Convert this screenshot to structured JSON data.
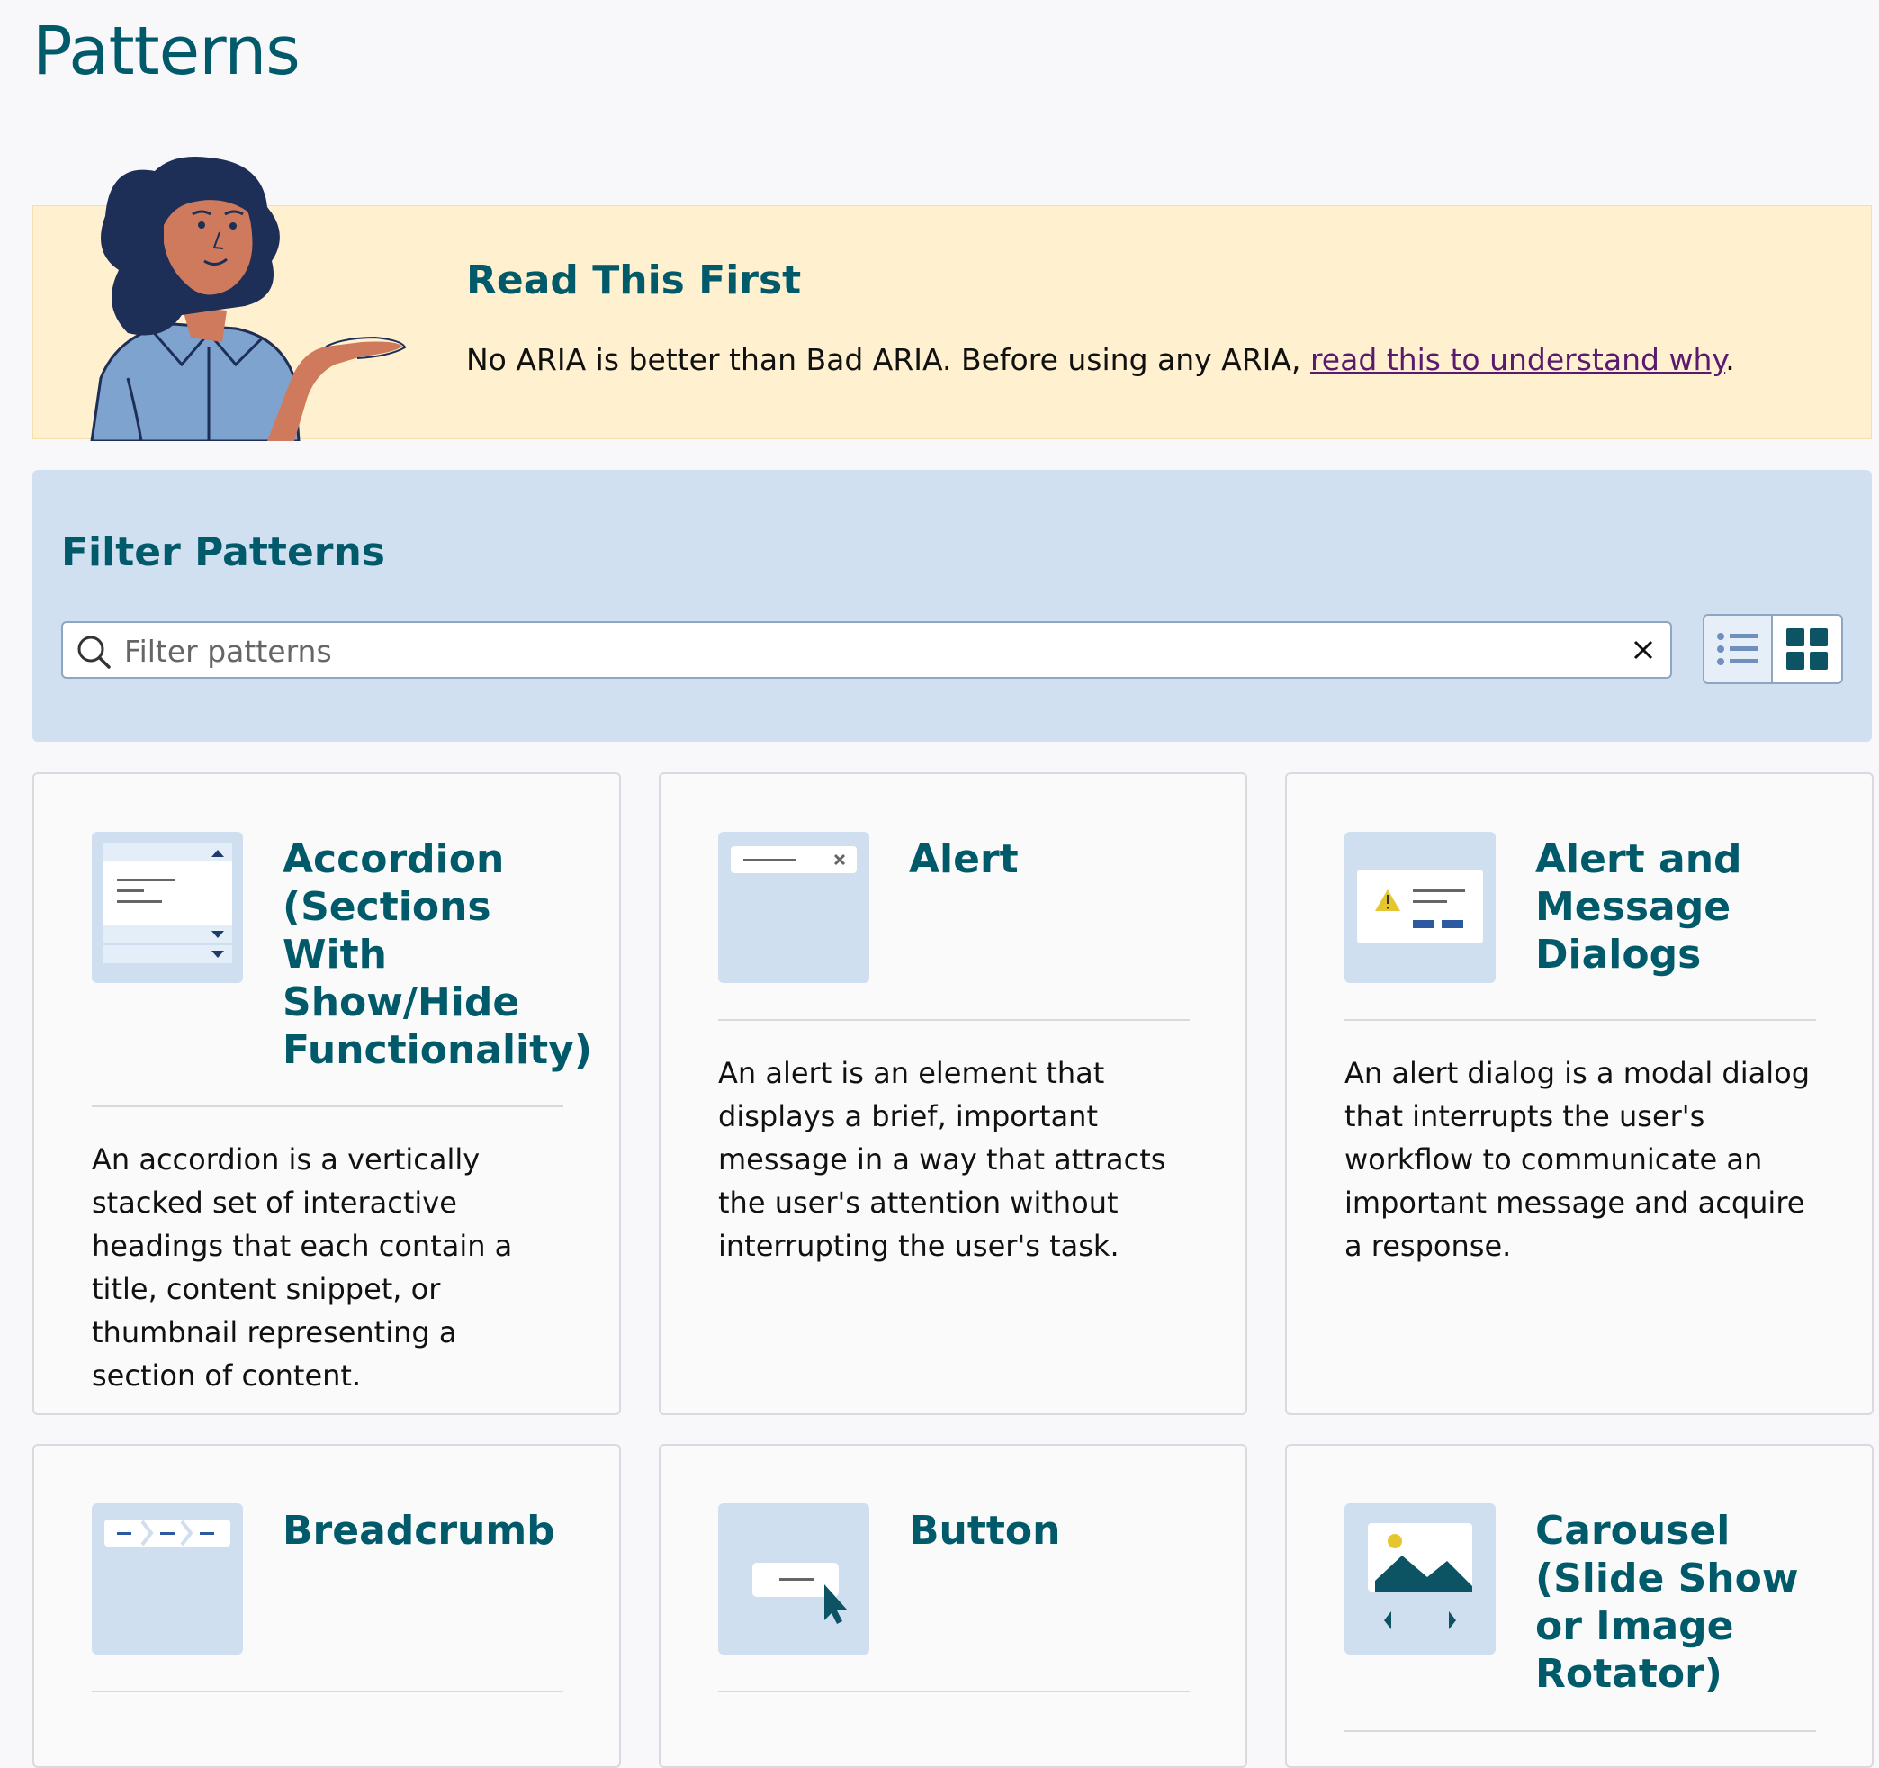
{
  "page": {
    "title": "Patterns"
  },
  "banner": {
    "heading": "Read This First",
    "text_before": "No ARIA is better than Bad ARIA. Before using any ARIA, ",
    "link_text": "read this to understand why",
    "text_after": "."
  },
  "filter": {
    "heading": "Filter Patterns",
    "placeholder": "Filter patterns",
    "value": "",
    "view_mode": "grid"
  },
  "cards": [
    {
      "title": "Accordion (Sections With Show/Hide Functionality)",
      "description": "An accordion is a vertically stacked set of interactive headings that each contain a title, content snippet, or thumbnail representing a section of content.",
      "icon": "accordion-icon"
    },
    {
      "title": "Alert",
      "description": "An alert is an element that displays a brief, important message in a way that attracts the user's attention without interrupting the user's task.",
      "icon": "alert-icon"
    },
    {
      "title": "Alert and Message Dialogs",
      "description": "An alert dialog is a modal dialog that interrupts the user's workflow to communicate an important message and acquire a response.",
      "icon": "alert-dialog-icon"
    },
    {
      "title": "Breadcrumb",
      "description": "",
      "icon": "breadcrumb-icon"
    },
    {
      "title": "Button",
      "description": "",
      "icon": "button-icon"
    },
    {
      "title": "Carousel (Slide Show or Image Rotator)",
      "description": "",
      "icon": "carousel-icon"
    }
  ],
  "colors": {
    "heading": "#005a6a",
    "banner_bg": "#fff0cf",
    "filter_bg": "#d1e0f0",
    "icon_bg": "#cfdfef",
    "link": "#5a1a6e"
  }
}
